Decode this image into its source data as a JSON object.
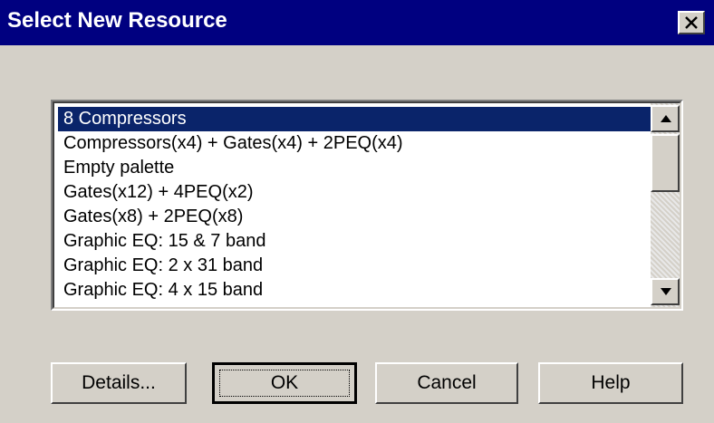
{
  "window": {
    "title": "Select New Resource"
  },
  "list": {
    "items": [
      "8 Compressors",
      "Compressors(x4) + Gates(x4) + 2PEQ(x4)",
      "Empty palette",
      "Gates(x12) + 4PEQ(x2)",
      "Gates(x8) + 2PEQ(x8)",
      "Graphic EQ: 15 & 7 band",
      "Graphic EQ: 2 x 31 band",
      "Graphic EQ: 4 x 15 band"
    ],
    "selected_index": 0
  },
  "buttons": {
    "details": "Details...",
    "ok": "OK",
    "cancel": "Cancel",
    "help": "Help"
  },
  "icons": {
    "close": "close-icon",
    "scroll_up": "arrow-up-icon",
    "scroll_down": "arrow-down-icon"
  },
  "colors": {
    "titlebar": "#000080",
    "selection": "#0a246a",
    "face": "#d4d0c8"
  }
}
